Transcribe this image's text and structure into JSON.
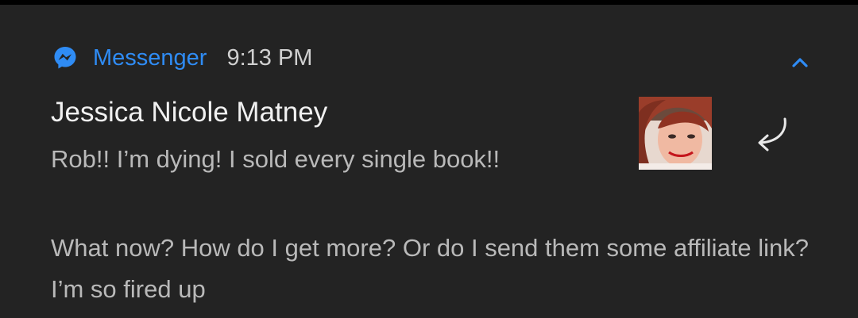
{
  "notification": {
    "app_name": "Messenger",
    "time": "9:13 PM",
    "sender": "Jessica Nicole Matney",
    "message_line1": "Rob!! I’m dying! I sold every single book!!",
    "message_para2": "What now? How do I get more? Or do I send them some affiliate link? I’m so fired up",
    "icons": {
      "app": "messenger-icon",
      "collapse": "chevron-up-icon",
      "reply": "reply-arrow-icon",
      "avatar": "sender-avatar"
    },
    "colors": {
      "background": "#232323",
      "accent": "#2f8cf5",
      "title_text": "#f1f1f1",
      "body_text": "#b9b9b9"
    }
  }
}
